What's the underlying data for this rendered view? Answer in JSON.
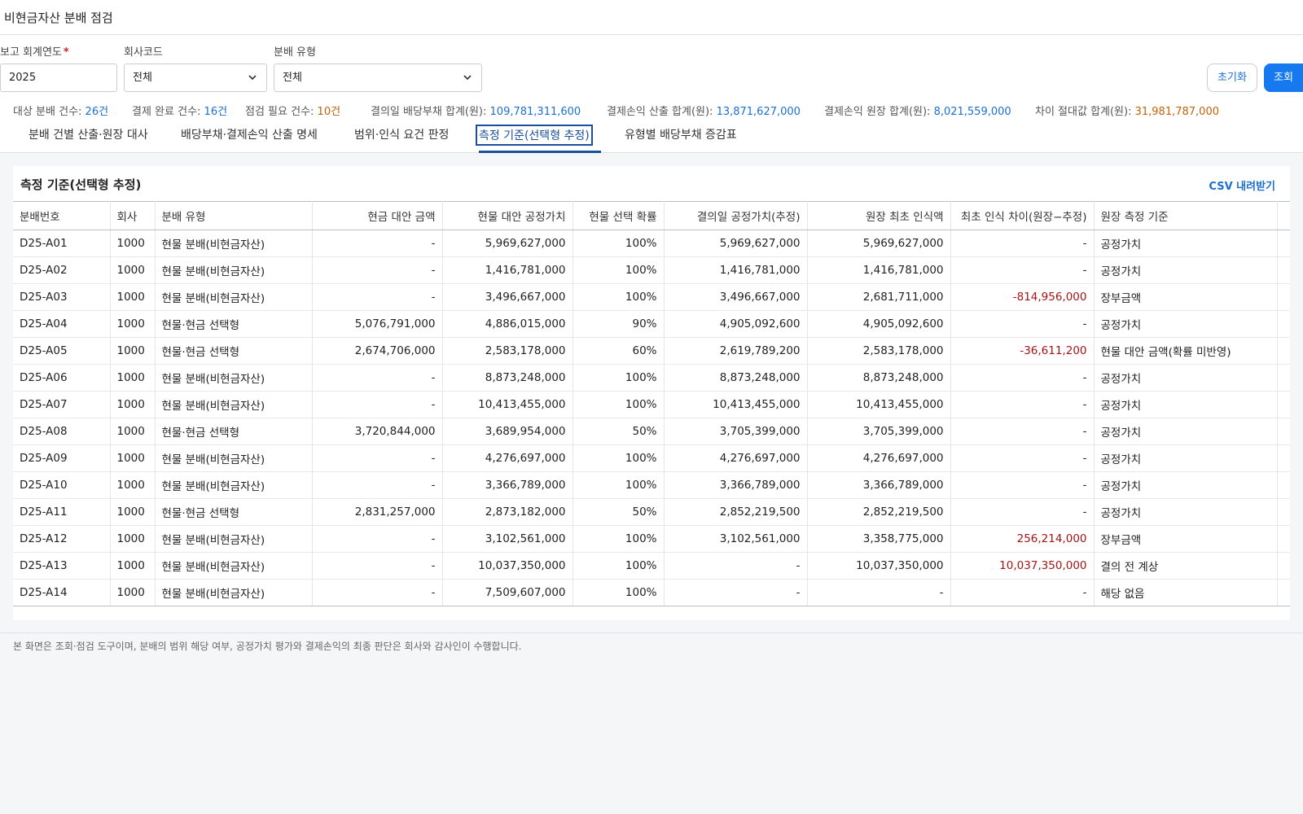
{
  "header": {
    "title": "비현금자산 분배 점검"
  },
  "filters": {
    "year": {
      "label": "보고 회계연도",
      "required_mark": "*",
      "value": "2025"
    },
    "company": {
      "label": "회사코드",
      "value": "전체"
    },
    "dist_type": {
      "label": "분배 유형",
      "value": "전체"
    },
    "reset_label": "초기화",
    "search_label": "조회"
  },
  "summary": [
    {
      "label": "대상 분배 건수:",
      "value": "26건",
      "color": "#1a6fd1"
    },
    {
      "label": "결제 완료 건수:",
      "value": "16건",
      "color": "#1a6fd1"
    },
    {
      "label": "점검 필요 건수:",
      "value": "10건",
      "color": "#c2620a"
    },
    {
      "label": "결의일 배당부채 합계(원):",
      "value": "109,781,311,600",
      "color": "#1a6fd1"
    },
    {
      "label": "결제손익 산출 합계(원):",
      "value": "13,871,627,000",
      "color": "#1a6fd1"
    },
    {
      "label": "결제손익 원장 합계(원):",
      "value": "8,021,559,000",
      "color": "#1a6fd1"
    },
    {
      "label": "차이 절대값 합계(원):",
      "value": "31,981,787,000",
      "color": "#c2620a"
    }
  ],
  "tabs": [
    {
      "label": "분배 건별 산출·원장 대사"
    },
    {
      "label": "배당부채·결제손익 산출 명세"
    },
    {
      "label": "범위·인식 요건 판정"
    },
    {
      "label": "측정 기준(선택형 추정)"
    },
    {
      "label": "유형별 배당부채 증감표"
    }
  ],
  "active_tab": 3,
  "panel": {
    "title": "측정 기준(선택형 추정)",
    "csv_label": "CSV 내려받기",
    "columns": [
      "분배번호",
      "회사",
      "분배 유형",
      "현금 대안 금액",
      "현물 대안 공정가치",
      "현물 선택 확률",
      "결의일 공정가치(추정)",
      "원장 최초 인식액",
      "최초 인식 차이(원장−추정)",
      "원장 측정 기준"
    ],
    "rows": [
      [
        "D25-A01",
        "1000",
        "현물 분배(비현금자산)",
        "-",
        "5,969,627,000",
        "100%",
        "5,969,627,000",
        "5,969,627,000",
        "-",
        "공정가치"
      ],
      [
        "D25-A02",
        "1000",
        "현물 분배(비현금자산)",
        "-",
        "1,416,781,000",
        "100%",
        "1,416,781,000",
        "1,416,781,000",
        "-",
        "공정가치"
      ],
      [
        "D25-A03",
        "1000",
        "현물 분배(비현금자산)",
        "-",
        "3,496,667,000",
        "100%",
        "3,496,667,000",
        "2,681,711,000",
        "-814,956,000",
        "장부금액"
      ],
      [
        "D25-A04",
        "1000",
        "현물·현금 선택형",
        "5,076,791,000",
        "4,886,015,000",
        "90%",
        "4,905,092,600",
        "4,905,092,600",
        "-",
        "공정가치"
      ],
      [
        "D25-A05",
        "1000",
        "현물·현금 선택형",
        "2,674,706,000",
        "2,583,178,000",
        "60%",
        "2,619,789,200",
        "2,583,178,000",
        "-36,611,200",
        "현물 대안 금액(확률 미반영)"
      ],
      [
        "D25-A06",
        "1000",
        "현물 분배(비현금자산)",
        "-",
        "8,873,248,000",
        "100%",
        "8,873,248,000",
        "8,873,248,000",
        "-",
        "공정가치"
      ],
      [
        "D25-A07",
        "1000",
        "현물 분배(비현금자산)",
        "-",
        "10,413,455,000",
        "100%",
        "10,413,455,000",
        "10,413,455,000",
        "-",
        "공정가치"
      ],
      [
        "D25-A08",
        "1000",
        "현물·현금 선택형",
        "3,720,844,000",
        "3,689,954,000",
        "50%",
        "3,705,399,000",
        "3,705,399,000",
        "-",
        "공정가치"
      ],
      [
        "D25-A09",
        "1000",
        "현물 분배(비현금자산)",
        "-",
        "4,276,697,000",
        "100%",
        "4,276,697,000",
        "4,276,697,000",
        "-",
        "공정가치"
      ],
      [
        "D25-A10",
        "1000",
        "현물 분배(비현금자산)",
        "-",
        "3,366,789,000",
        "100%",
        "3,366,789,000",
        "3,366,789,000",
        "-",
        "공정가치"
      ],
      [
        "D25-A11",
        "1000",
        "현물·현금 선택형",
        "2,831,257,000",
        "2,873,182,000",
        "50%",
        "2,852,219,500",
        "2,852,219,500",
        "-",
        "공정가치"
      ],
      [
        "D25-A12",
        "1000",
        "현물 분배(비현금자산)",
        "-",
        "3,102,561,000",
        "100%",
        "3,102,561,000",
        "3,358,775,000",
        "256,214,000",
        "장부금액"
      ],
      [
        "D25-A13",
        "1000",
        "현물 분배(비현금자산)",
        "-",
        "10,037,350,000",
        "100%",
        "-",
        "10,037,350,000",
        "10,037,350,000",
        "결의 전 계상"
      ],
      [
        "D25-A14",
        "1000",
        "현물 분배(비현금자산)",
        "-",
        "7,509,607,000",
        "100%",
        "-",
        "-",
        "-",
        "해당 없음"
      ]
    ]
  },
  "footer": {
    "note": "본 화면은 조회·점검 도구이며, 분배의 범위 해당 여부, 공정가치 평가와 결제손익의 최종 판단은 회사와 감사인이 수행합니다."
  },
  "colors": {
    "accent": "#1679f0",
    "link": "#1a6fd1",
    "warn": "#c2620a",
    "negative": "#a31515",
    "tab_active": "#1a4f9c"
  }
}
